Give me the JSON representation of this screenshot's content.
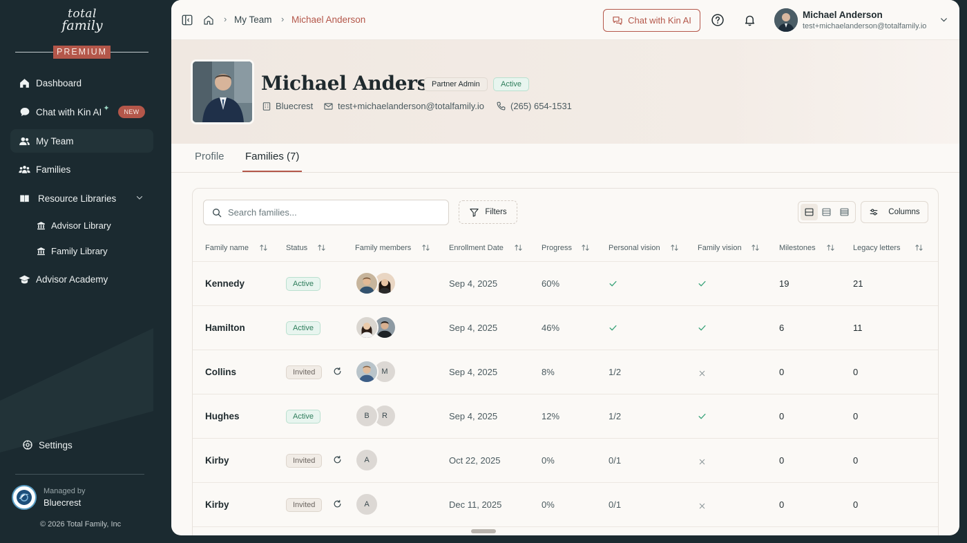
{
  "sidebar": {
    "logo_line1": "total",
    "logo_line2": "family",
    "premium": "PREMIUM",
    "items": [
      {
        "label": "Dashboard",
        "icon": "home-icon"
      },
      {
        "label": "Chat with Kin AI",
        "icon": "chat-bubble-icon",
        "badge": "NEW"
      },
      {
        "label": "My Team",
        "icon": "team-icon"
      },
      {
        "label": "Families",
        "icon": "families-icon"
      },
      {
        "label": "Resource Libraries",
        "icon": "book-icon"
      },
      {
        "label": "Advisor Library",
        "icon": "library-icon"
      },
      {
        "label": "Family Library",
        "icon": "library-icon"
      },
      {
        "label": "Advisor Academy",
        "icon": "graduation-cap-icon"
      }
    ],
    "settings": "Settings",
    "managed_by_label": "Managed by",
    "managed_by_name": "Bluecrest",
    "copyright": "© 2026 Total Family, Inc"
  },
  "topbar": {
    "breadcrumb": [
      "My Team",
      "Michael Anderson"
    ],
    "kin_button": "Chat with Kin AI",
    "user_name": "Michael Anderson",
    "user_email": "test+michaelanderson@totalfamily.io"
  },
  "profile": {
    "name": "Michael Anderson",
    "role": "Partner Admin",
    "status": "Active",
    "company": "Bluecrest",
    "email": "test+michaelanderson@totalfamily.io",
    "phone": "(265) 654-1531"
  },
  "tabs": {
    "profile": "Profile",
    "families": "Families (7)"
  },
  "toolbar": {
    "search_placeholder": "Search families...",
    "filters": "Filters",
    "columns": "Columns"
  },
  "table": {
    "headers": [
      "Family name",
      "Status",
      "Family members",
      "Enrollment Date",
      "Progress",
      "Personal vision",
      "Family vision",
      "Milestones",
      "Legacy letters"
    ],
    "rows": [
      {
        "name": "Kennedy",
        "status": "Active",
        "members": [
          "photo",
          "photo"
        ],
        "date": "Sep 4, 2025",
        "progress": "60%",
        "personal_vision": "check",
        "family_vision": "check",
        "milestones": "19",
        "letters": "21"
      },
      {
        "name": "Hamilton",
        "status": "Active",
        "members": [
          "photo",
          "photo"
        ],
        "date": "Sep 4, 2025",
        "progress": "46%",
        "personal_vision": "check",
        "family_vision": "check",
        "milestones": "6",
        "letters": "11"
      },
      {
        "name": "Collins",
        "status": "Invited",
        "members": [
          "photo",
          "M"
        ],
        "date": "Sep 4, 2025",
        "progress": "8%",
        "personal_vision": "1/2",
        "family_vision": "x",
        "milestones": "0",
        "letters": "0"
      },
      {
        "name": "Hughes",
        "status": "Active",
        "members": [
          "B",
          "R"
        ],
        "date": "Sep 4, 2025",
        "progress": "12%",
        "personal_vision": "1/2",
        "family_vision": "check",
        "milestones": "0",
        "letters": "0"
      },
      {
        "name": "Kirby",
        "status": "Invited",
        "members": [
          "A"
        ],
        "date": "Oct 22, 2025",
        "progress": "0%",
        "personal_vision": "0/1",
        "family_vision": "x",
        "milestones": "0",
        "letters": "0"
      },
      {
        "name": "Kirby",
        "status": "Invited",
        "members": [
          "A"
        ],
        "date": "Dec 11, 2025",
        "progress": "0%",
        "personal_vision": "0/1",
        "family_vision": "x",
        "milestones": "0",
        "letters": "0"
      }
    ]
  },
  "colors": {
    "accent": "#b4574a",
    "sidebar_bg": "#1b2a30",
    "active_green": "#2e7d5b",
    "check_green": "#3aa37a"
  }
}
